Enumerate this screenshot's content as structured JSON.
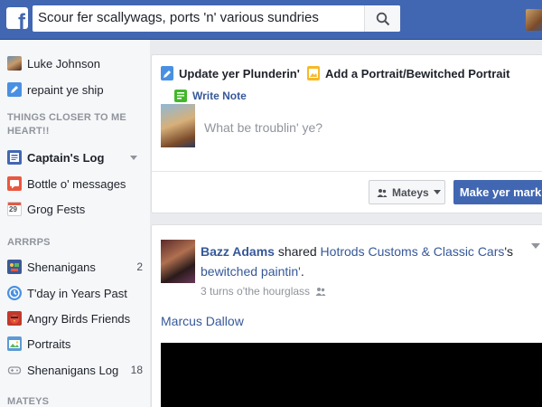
{
  "header": {
    "logo": "f",
    "search_value": "Scour fer scallywags, ports 'n' various sundries",
    "icons": {
      "search": "search-icon",
      "avatar": "profile-avatar"
    }
  },
  "sidebar": {
    "profile": {
      "name": "Luke Johnson",
      "edit": "repaint ye ship"
    },
    "section1_title": "THINGS CLOSER TO ME HEART!!",
    "section1": [
      {
        "label": "Captain's Log",
        "bold": true,
        "icon": "news-feed-icon",
        "color": "#4267b2"
      },
      {
        "label": "Bottle o' messages",
        "icon": "messages-icon",
        "color": "#e9573f"
      },
      {
        "label": "Grog Fests",
        "icon": "calendar-icon",
        "color": "#ffffff",
        "badge": "29"
      }
    ],
    "section2_title": "ARRRPS",
    "section2": [
      {
        "label": "Shenanigans",
        "count": "2",
        "icon": "games-icon",
        "color": "#3b5998"
      },
      {
        "label": "T'day in Years Past",
        "icon": "on-this-day-icon",
        "color": "#4a90e2"
      },
      {
        "label": "Angry Birds Friends",
        "icon": "angry-birds-icon",
        "color": "#c0392b"
      },
      {
        "label": "Portraits",
        "icon": "photos-icon",
        "color": "#5b9bd5"
      },
      {
        "label": "Shenanigans Log",
        "count": "18",
        "icon": "gamepad-icon",
        "color": "#90949c"
      }
    ],
    "section3_title": "MATEYS"
  },
  "composer": {
    "tab_status": "Update yer Plunderin'",
    "tab_photo": "Add a Portrait/Bewitched Portrait",
    "write_note": "Write Note",
    "placeholder": "What be troublin' ye?",
    "audience": "Mateys",
    "post_button": "Make yer mark"
  },
  "story": {
    "author": "Bazz Adams",
    "verb": " shared ",
    "page": "Hotrods Customs & Classic Cars",
    "possessive": "'s",
    "object": "bewitched paintin'",
    "period": ".",
    "time": "3 turns o'the hourglass",
    "shared_name": "Marcus Dallow"
  },
  "colors": {
    "brand": "#4267b2",
    "link": "#365899",
    "background": "#e9ebee"
  }
}
